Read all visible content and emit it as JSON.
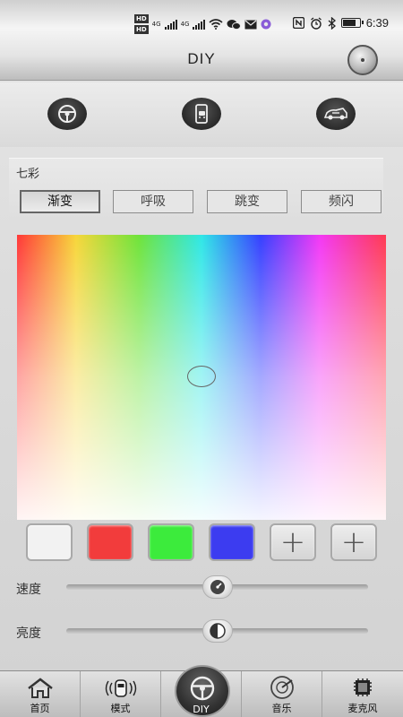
{
  "status_bar": {
    "hd1": "HD",
    "hd2": "HD",
    "net1": "4G",
    "net2": "4G",
    "time": "6:39"
  },
  "header": {
    "title": "DIY"
  },
  "mode_icons": [
    {
      "icon": "steering-wheel-icon"
    },
    {
      "icon": "phone-car-icon"
    },
    {
      "icon": "car-sport-icon"
    }
  ],
  "colors_panel": {
    "label": "七彩",
    "tabs": [
      {
        "label": "渐变",
        "active": true
      },
      {
        "label": "呼吸",
        "active": false
      },
      {
        "label": "跳变",
        "active": false
      },
      {
        "label": "频闪",
        "active": false
      }
    ]
  },
  "swatches": {
    "colors": [
      "#f2f2f2",
      "#f23c3c",
      "#3ceb3c",
      "#3c3cf0"
    ],
    "add_label": "+"
  },
  "sliders": {
    "speed": {
      "label": "速度",
      "value": 0.5
    },
    "brightness": {
      "label": "亮度",
      "value": 0.5
    }
  },
  "bottom_nav": [
    {
      "label": "首页",
      "icon": "home-icon"
    },
    {
      "label": "模式",
      "icon": "car-mode-icon"
    },
    {
      "label": "DIY",
      "icon": "steering-wheel-icon",
      "active": true
    },
    {
      "label": "音乐",
      "icon": "music-disc-icon"
    },
    {
      "label": "麦克风",
      "icon": "microphone-icon"
    }
  ]
}
